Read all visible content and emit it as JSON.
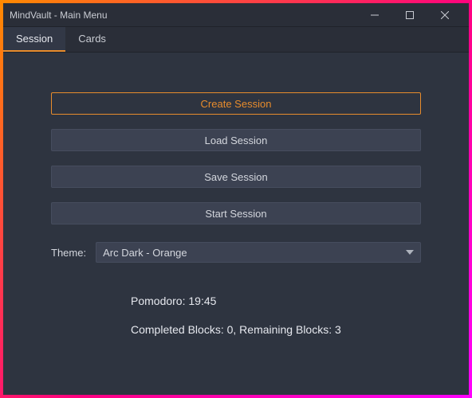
{
  "window": {
    "title": "MindVault - Main Menu"
  },
  "tabs": [
    {
      "label": "Session",
      "active": true
    },
    {
      "label": "Cards",
      "active": false
    }
  ],
  "buttons": {
    "create": "Create Session",
    "load": "Load Session",
    "save": "Save Session",
    "start": "Start Session"
  },
  "theme": {
    "label": "Theme:",
    "selected": "Arc Dark - Orange"
  },
  "status": {
    "pomodoro": "Pomodoro: 19:45",
    "blocks": "Completed Blocks: 0, Remaining Blocks: 3"
  }
}
